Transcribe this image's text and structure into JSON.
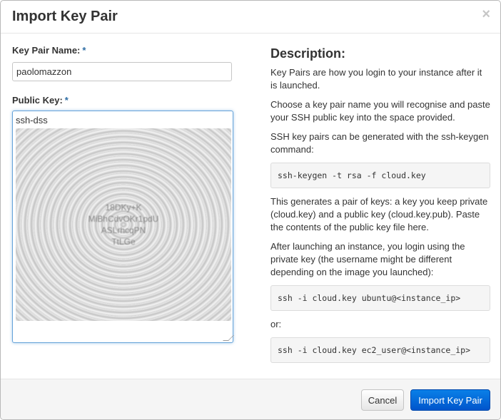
{
  "dialog": {
    "title": "Import Key Pair",
    "close_glyph": "×"
  },
  "form": {
    "key_pair_name": {
      "label": "Key Pair Name:",
      "required_mark": "*",
      "value": "paolomazzon"
    },
    "public_key": {
      "label": "Public Key:",
      "required_mark": "*",
      "value": "ssh-dss",
      "obscured_fragments": [
        "18DKy+K",
        "MiBhCdvOKr1pdU",
        "ASLrhcqPN",
        "TtLGe"
      ]
    }
  },
  "description": {
    "title": "Description:",
    "paragraph_1": "Key Pairs are how you login to your instance after it is launched.",
    "paragraph_2": "Choose a key pair name you will recognise and paste your SSH public key into the space provided.",
    "paragraph_3": "SSH key pairs can be generated with the ssh-keygen command:",
    "code_1": "ssh-keygen -t rsa -f cloud.key",
    "paragraph_4": "This generates a pair of keys: a key you keep private (cloud.key) and a public key (cloud.key.pub). Paste the contents of the public key file here.",
    "paragraph_5": "After launching an instance, you login using the private key (the username might be different depending on the image you launched):",
    "code_2": "ssh -i cloud.key ubuntu@<instance_ip>",
    "or_label": "or:",
    "code_3": "ssh -i cloud.key ec2_user@<instance_ip>"
  },
  "footer": {
    "cancel_label": "Cancel",
    "submit_label": "Import Key Pair"
  },
  "colors": {
    "primary": "#0a6fdc",
    "required": "#2e6da4",
    "focus_border": "#66a3d9"
  }
}
